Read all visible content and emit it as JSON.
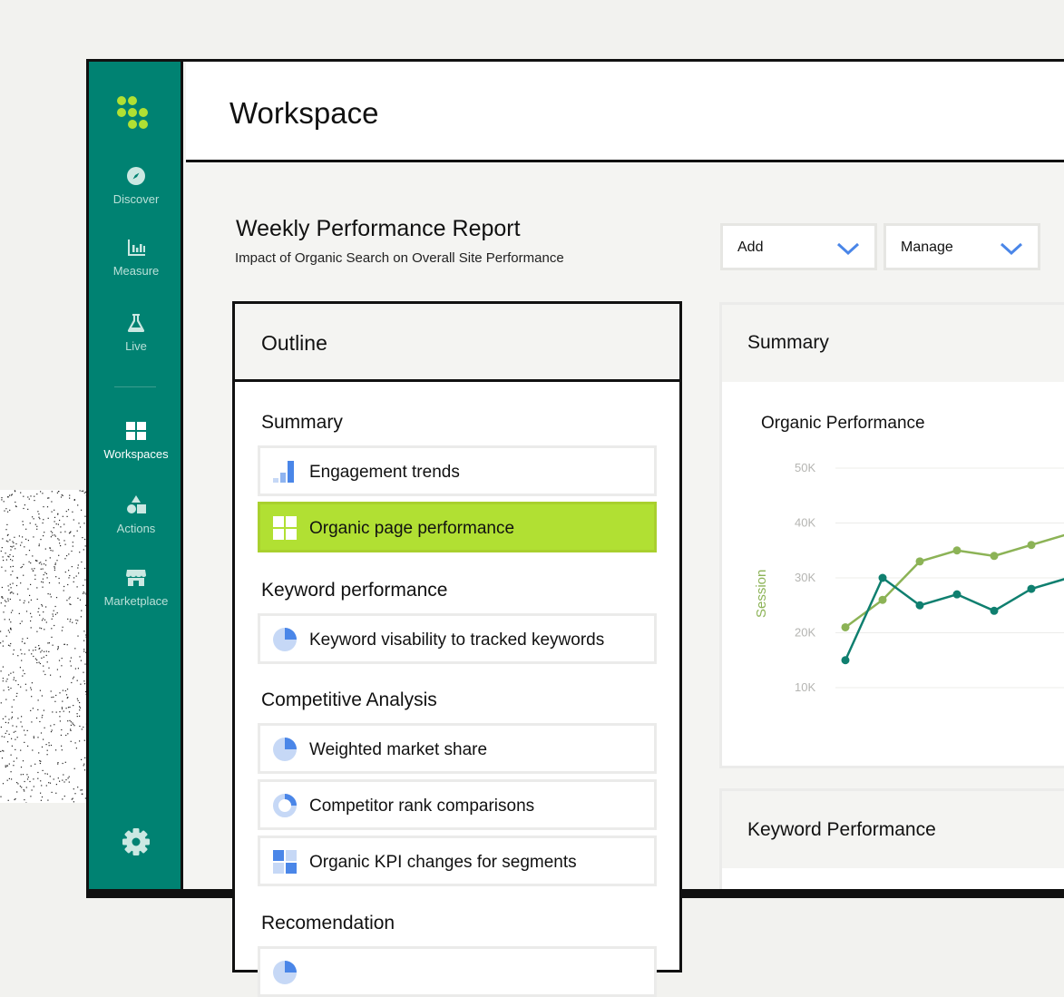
{
  "sidebar": {
    "items": [
      {
        "label": "Discover",
        "icon": "compass-icon"
      },
      {
        "label": "Measure",
        "icon": "bar-chart-icon"
      },
      {
        "label": "Live",
        "icon": "flask-icon"
      },
      {
        "label": "Workspaces",
        "icon": "grid-icon",
        "active": true
      },
      {
        "label": "Actions",
        "icon": "shapes-icon"
      },
      {
        "label": "Marketplace",
        "icon": "store-icon"
      }
    ],
    "settings_icon": "gear-icon"
  },
  "header": {
    "title": "Workspace"
  },
  "report": {
    "title": "Weekly Performance Report",
    "subtitle": "Impact of Organic Search on Overall Site Performance"
  },
  "toolbar": {
    "add_label": "Add",
    "manage_label": "Manage"
  },
  "outline": {
    "title": "Outline",
    "sections": [
      {
        "heading": "Summary",
        "items": [
          {
            "label": "Engagement trends",
            "icon": "bar-chart-icon"
          },
          {
            "label": "Organic page performance",
            "icon": "grid-icon",
            "selected": true
          }
        ]
      },
      {
        "heading": "Keyword performance",
        "items": [
          {
            "label": "Keyword visability to tracked keywords",
            "icon": "pie-chart-icon"
          }
        ]
      },
      {
        "heading": "Competitive Analysis",
        "items": [
          {
            "label": "Weighted market share",
            "icon": "pie-chart-icon"
          },
          {
            "label": "Competitor rank comparisons",
            "icon": "donut-chart-icon"
          },
          {
            "label": "Organic KPI changes for segments",
            "icon": "grid-icon"
          }
        ]
      },
      {
        "heading": "Recomendation",
        "items": []
      }
    ]
  },
  "summary_card": {
    "title": "Summary"
  },
  "keyword_card": {
    "title": "Keyword Performance"
  },
  "colors": {
    "sidebar": "#008272",
    "accent_lime": "#b1e033",
    "series_light": "#8cb356",
    "series_dark": "#0f7f6f",
    "icon_blue": "#4a86e8"
  },
  "chart_data": {
    "type": "line",
    "title": "Organic Performance",
    "ylabel": "Session",
    "ylim": [
      10000,
      50000
    ],
    "yticks": [
      "10K",
      "20K",
      "30K",
      "40K",
      "50K"
    ],
    "grid": true,
    "series": [
      {
        "values": [
          21000,
          26000,
          33000,
          35000,
          34000,
          36000,
          38000
        ]
      },
      {
        "values": [
          15000,
          30000,
          25000,
          27000,
          24000,
          28000,
          30000
        ]
      }
    ]
  }
}
